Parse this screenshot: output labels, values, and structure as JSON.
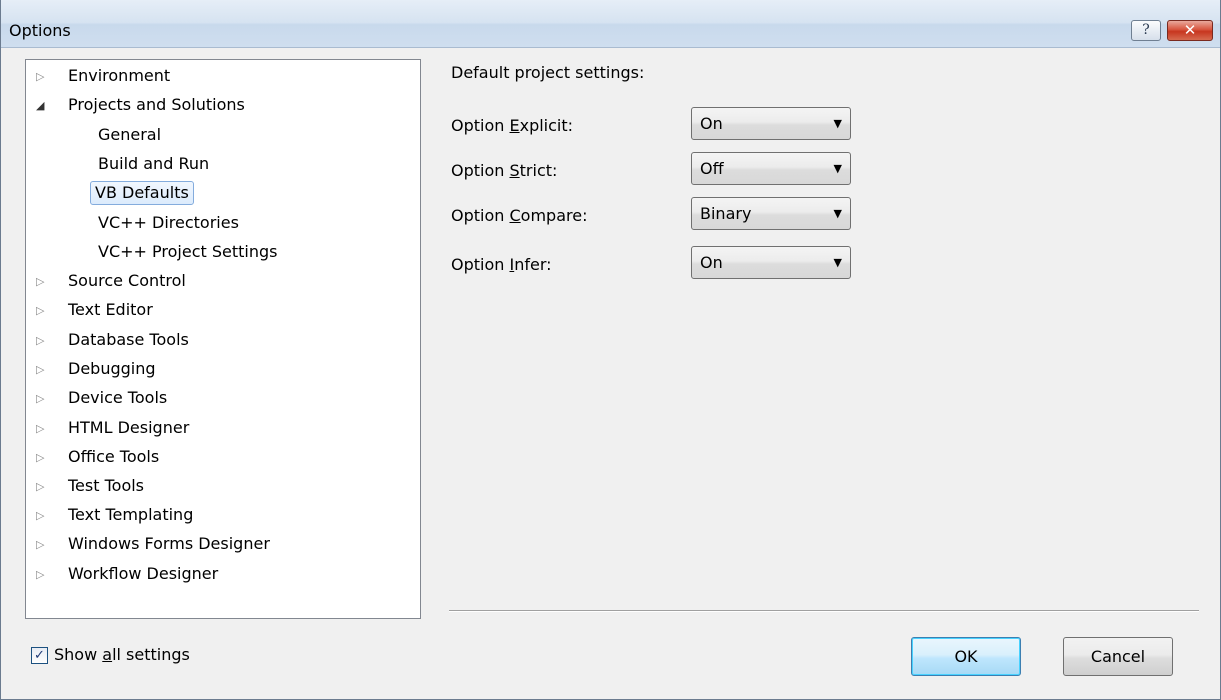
{
  "window": {
    "title": "Options",
    "help_glyph": "?",
    "close_glyph": "✕"
  },
  "tree": {
    "items": [
      {
        "label": "Environment",
        "expander": "▷"
      },
      {
        "label": "Projects and Solutions",
        "expander": "◢"
      },
      {
        "label": "General"
      },
      {
        "label": "Build and Run"
      },
      {
        "label": "VB Defaults",
        "selected": true
      },
      {
        "label": "VC++ Directories"
      },
      {
        "label": "VC++ Project Settings"
      },
      {
        "label": "Source Control",
        "expander": "▷"
      },
      {
        "label": "Text Editor",
        "expander": "▷"
      },
      {
        "label": "Database Tools",
        "expander": "▷"
      },
      {
        "label": "Debugging",
        "expander": "▷"
      },
      {
        "label": "Device Tools",
        "expander": "▷"
      },
      {
        "label": "HTML Designer",
        "expander": "▷"
      },
      {
        "label": "Office Tools",
        "expander": "▷"
      },
      {
        "label": "Test Tools",
        "expander": "▷"
      },
      {
        "label": "Text Templating",
        "expander": "▷"
      },
      {
        "label": "Windows Forms Designer",
        "expander": "▷"
      },
      {
        "label": "Workflow Designer",
        "expander": "▷"
      }
    ]
  },
  "settings": {
    "heading": "Default project settings:",
    "options": [
      {
        "pre": "Option ",
        "key": "E",
        "post": "xplicit:",
        "value": "On"
      },
      {
        "pre": "Option ",
        "key": "S",
        "post": "trict:",
        "value": "Off"
      },
      {
        "pre": "Option ",
        "key": "C",
        "post": "ompare:",
        "value": "Binary"
      },
      {
        "pre": "Option ",
        "key": "I",
        "post": "nfer:",
        "value": "On"
      }
    ],
    "combo_arrow": "▼"
  },
  "footer": {
    "show_all": {
      "pre": "Show ",
      "key": "a",
      "post": "ll settings",
      "checked": true,
      "check_glyph": "✓"
    },
    "ok_label": "OK",
    "cancel_label": "Cancel"
  },
  "colors": {
    "selection_border": "#84acdd",
    "title_gradient_top": "#e6eef7",
    "close_red": "#c7361f"
  }
}
